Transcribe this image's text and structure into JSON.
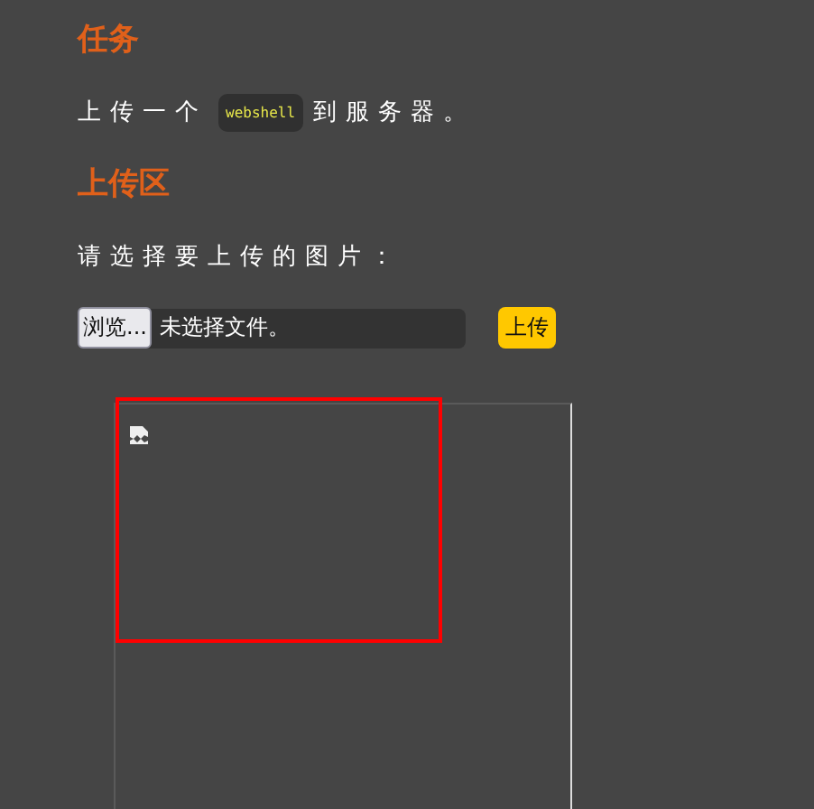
{
  "task": {
    "heading": "任务",
    "text_before": "上传一个",
    "code": "webshell",
    "text_after": "到服务器。"
  },
  "upload": {
    "heading": "上传区",
    "prompt": "请选择要上传的图片：",
    "browse_button": "浏览...",
    "file_status": "未选择文件。",
    "submit_button": "上传"
  },
  "preview": {
    "image_broken": true
  }
}
